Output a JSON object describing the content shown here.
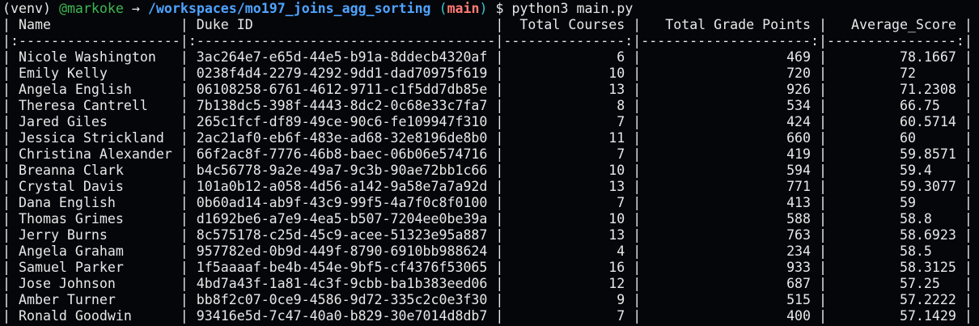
{
  "prompt": {
    "venv": "(venv)",
    "user": "@markoke",
    "arrow": "→",
    "path": "/workspaces/mo197_joins_agg_sorting",
    "branch_open": "(",
    "branch": "main",
    "branch_close": ")",
    "symbol": "$",
    "command": "python3 main.py"
  },
  "table": {
    "headers": [
      "Name",
      "Duke ID",
      "Total Courses",
      "Total Grade Points",
      "Average_Score"
    ],
    "separator": "|:--------------------|:-------------------------------------|---------------:|---------------------:|----------------:|",
    "rows": [
      [
        "Nicole Washington",
        "3ac264e7-e65d-44e5-b91a-8ddecb4320af",
        "6",
        "469",
        "78.1667"
      ],
      [
        "Emily Kelly",
        "0238f4d4-2279-4292-9dd1-dad70975f619",
        "10",
        "720",
        "72"
      ],
      [
        "Angela English",
        "06108258-6761-4612-9711-c1f5dd7db85e",
        "13",
        "926",
        "71.2308"
      ],
      [
        "Theresa Cantrell",
        "7b138dc5-398f-4443-8dc2-0c68e33c7fa7",
        "8",
        "534",
        "66.75"
      ],
      [
        "Jared Giles",
        "265c1fcf-df89-49ce-90c6-fe109947f310",
        "7",
        "424",
        "60.5714"
      ],
      [
        "Jessica Strickland",
        "2ac21af0-eb6f-483e-ad68-32e8196de8b0",
        "11",
        "660",
        "60"
      ],
      [
        "Christina Alexander",
        "66f2ac8f-7776-46b8-baec-06b06e574716",
        "7",
        "419",
        "59.8571"
      ],
      [
        "Breanna Clark",
        "b4c56778-9a2e-49a7-9c3b-90ae72bb1c66",
        "10",
        "594",
        "59.4"
      ],
      [
        "Crystal Davis",
        "101a0b12-a058-4d56-a142-9a58e7a7a92d",
        "13",
        "771",
        "59.3077"
      ],
      [
        "Dana English",
        "0b60ad14-ab9f-43c9-99f5-4a7f0c8f0100",
        "7",
        "413",
        "59"
      ],
      [
        "Thomas Grimes",
        "d1692be6-a7e9-4ea5-b507-7204ee0be39a",
        "10",
        "588",
        "58.8"
      ],
      [
        "Jerry Burns",
        "8c575178-c25d-45c9-acee-51323e95a887",
        "13",
        "763",
        "58.6923"
      ],
      [
        "Angela Graham",
        "957782ed-0b9d-449f-8790-6910bb988624",
        "4",
        "234",
        "58.5"
      ],
      [
        "Samuel Parker",
        "1f5aaaaf-be4b-454e-9bf5-cf4376f53065",
        "16",
        "933",
        "58.3125"
      ],
      [
        "Jose Johnson",
        "4bd7a43f-1a81-4c3f-9cbb-ba1b383eed06",
        "12",
        "687",
        "57.25"
      ],
      [
        "Amber Turner",
        "bb8f2c07-0ce9-4586-9d72-335c2c0e3f30",
        "9",
        "515",
        "57.2222"
      ],
      [
        "Ronald Goodwin",
        "93416e5d-7c47-40a0-b829-30e7014d8db7",
        "7",
        "400",
        "57.1429"
      ]
    ]
  }
}
